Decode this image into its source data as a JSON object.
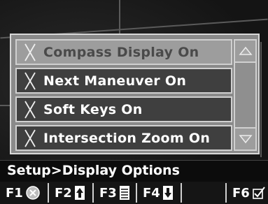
{
  "menu": {
    "items": [
      {
        "label": "Compass Display On",
        "checked": true,
        "style": "light"
      },
      {
        "label": "Next Maneuver On",
        "checked": true,
        "style": "dark"
      },
      {
        "label": "Soft Keys On",
        "checked": true,
        "style": "dark"
      },
      {
        "label": "Intersection Zoom On",
        "checked": true,
        "style": "dark"
      }
    ],
    "scroll_up_icon": "triangle-up-icon",
    "scroll_down_icon": "triangle-down-icon"
  },
  "status": {
    "breadcrumb": "Setup>Display Options"
  },
  "function_keys": [
    {
      "label": "F1",
      "icon": "cancel-circle-icon"
    },
    {
      "label": "F2",
      "icon": "page-up-icon"
    },
    {
      "label": "F3",
      "icon": "list-icon"
    },
    {
      "label": "F4",
      "icon": "page-down-icon"
    },
    {
      "label": "F6",
      "icon": "check-box-icon"
    }
  ],
  "colors": {
    "panel": "#8a8a8a",
    "item_dark": "#3f3f3f",
    "item_light": "#9d9d9d",
    "border": "#d0d0d0",
    "status_bg": "#0c0c0c"
  }
}
